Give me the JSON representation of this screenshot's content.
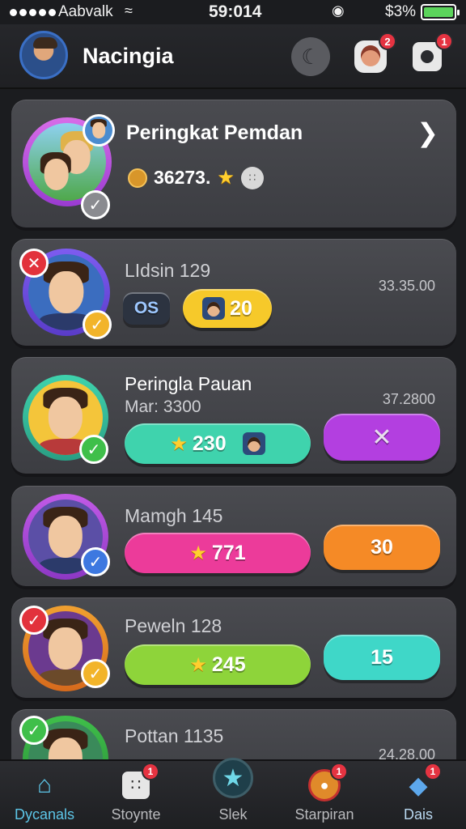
{
  "status_bar": {
    "carrier": "Aabvalk",
    "time": "59:014",
    "battery_pct": "$3%",
    "battery_level": 1.0
  },
  "header": {
    "title": "Nacingia",
    "notifications": {
      "face": "2",
      "gear": "1"
    }
  },
  "featured": {
    "title": "Peringkat Pemdan",
    "score": "36273."
  },
  "entries": [
    {
      "name": "LIdsin 129",
      "time": "33.35.00",
      "tag": "OS",
      "pill_value": "20"
    },
    {
      "name": "Peringla Pauan",
      "subtitle": "Mar: 3300",
      "time": "37.2800",
      "pill_value": "230"
    },
    {
      "name": "Mamgh 145",
      "pill_value": "771",
      "side_value": "30"
    },
    {
      "name": "Peweln 128",
      "pill_value": "245",
      "side_value": "15"
    },
    {
      "name": "Pottan 1135",
      "time": "24.28.00"
    }
  ],
  "colors": {
    "teal_pill": "#3fd3ad",
    "purple_pill": "#b33fe0",
    "pink_pill": "#ec3b9a",
    "orange_pill": "#f58a26",
    "green_pill": "#8ed43a",
    "aqua_pill": "#3fd7c8",
    "yellow_pill": "#f6c92a",
    "accent": "#5dc6e8"
  },
  "nav": {
    "items": [
      {
        "label": "Dycanals",
        "icon": "home-icon"
      },
      {
        "label": "Stoynte",
        "icon": "dice-icon",
        "badge": "1"
      },
      {
        "label": "Slek",
        "icon": "star-icon"
      },
      {
        "label": "Starpiran",
        "icon": "lion-icon",
        "badge": "1"
      },
      {
        "label": "Dais",
        "icon": "gem-icon",
        "badge": "1"
      }
    ]
  }
}
